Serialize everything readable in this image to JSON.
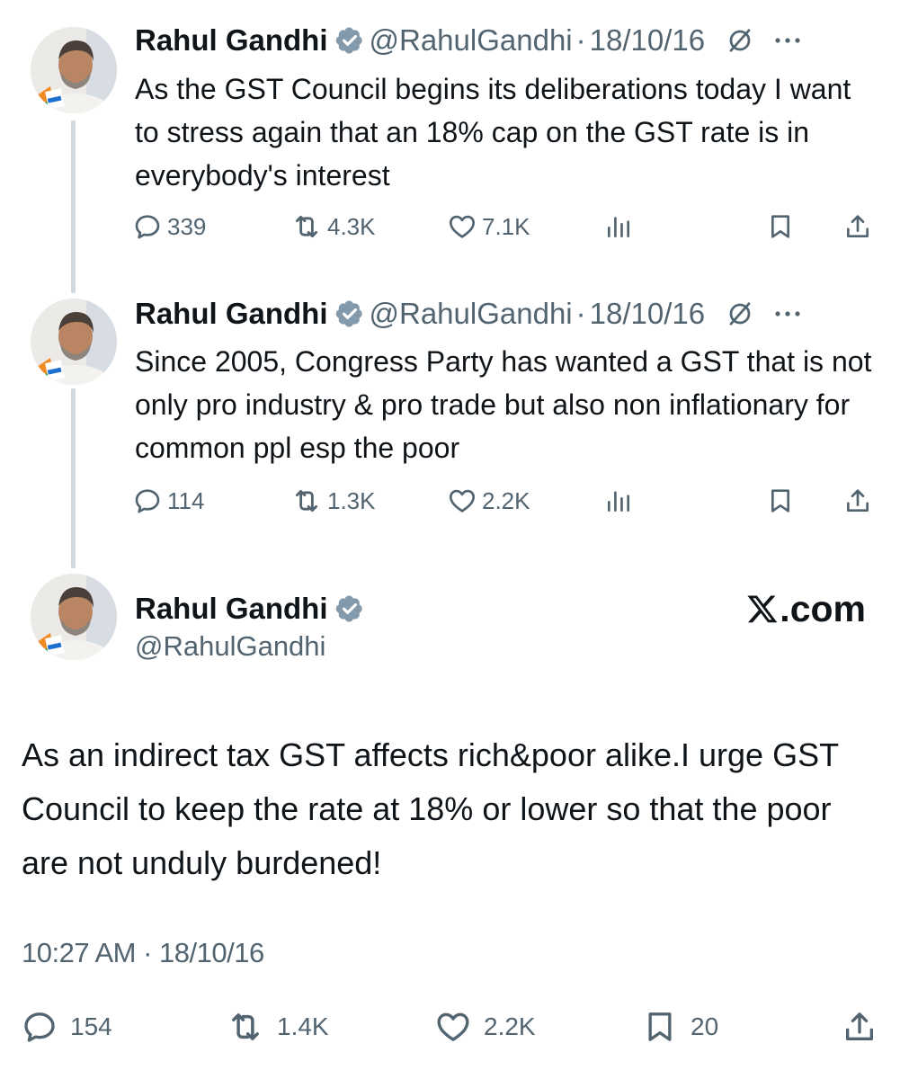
{
  "tweets": [
    {
      "author": "Rahul Gandhi",
      "handle": "@RahulGandhi",
      "separator": "·",
      "date": "18/10/16",
      "text": "As the GST Council begins its deliberations today I want to stress again that an 18% cap on the GST rate is in everybody's interest",
      "replies": "339",
      "reposts": "4.3K",
      "likes": "7.1K"
    },
    {
      "author": "Rahul Gandhi",
      "handle": "@RahulGandhi",
      "separator": "·",
      "date": "18/10/16",
      "text": "Since 2005, Congress Party has  wanted a GST that is not only pro industry & pro trade but also non inflationary for common ppl esp the poor",
      "replies": "114",
      "reposts": "1.3K",
      "likes": "2.2K"
    }
  ],
  "main_tweet": {
    "author": "Rahul Gandhi",
    "handle": "@RahulGandhi",
    "site_label": ".com",
    "text": "As an indirect tax GST affects rich&poor alike.I urge GST Council to keep the rate at 18% or lower so that the poor are not unduly burdened!",
    "timestamp": "10:27 AM · 18/10/16",
    "replies": "154",
    "reposts": "1.4K",
    "likes": "2.2K",
    "bookmarks": "20"
  },
  "icons": {
    "verified": "verified-badge-icon",
    "mute": "mute-icon",
    "more": "more-icon",
    "reply": "reply-icon",
    "repost": "repost-icon",
    "like": "like-icon",
    "views": "views-icon",
    "bookmark": "bookmark-icon",
    "share": "share-icon",
    "x_logo": "x-logo-icon"
  },
  "colors": {
    "text": "#0f1419",
    "secondary": "#536471",
    "thread_line": "#cfd9de",
    "verified_badge": "#829aab"
  }
}
